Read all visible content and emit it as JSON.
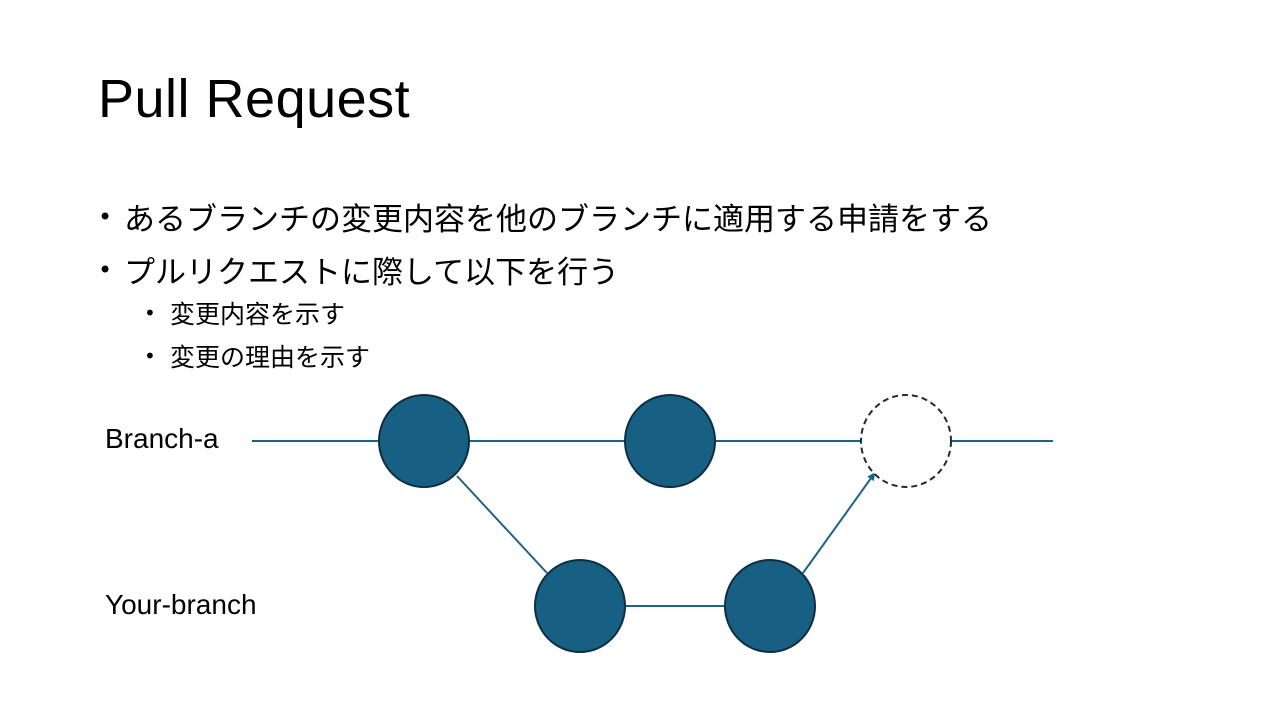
{
  "slide": {
    "title": "Pull Request",
    "bullets": [
      {
        "text": "あるブランチの変更内容を他のブランチに適用する申請をする"
      },
      {
        "text": "プルリクエストに際して以下を行う",
        "sub": [
          "変更内容を示す",
          "変更の理由を示す"
        ]
      }
    ]
  },
  "diagram": {
    "branches": [
      "Branch-a",
      "Your-branch"
    ],
    "colors": {
      "commit_fill": "#175f83",
      "commit_stroke": "#0f2f40",
      "line": "#1f6285",
      "pending_stroke": "#1a2e3a"
    }
  }
}
